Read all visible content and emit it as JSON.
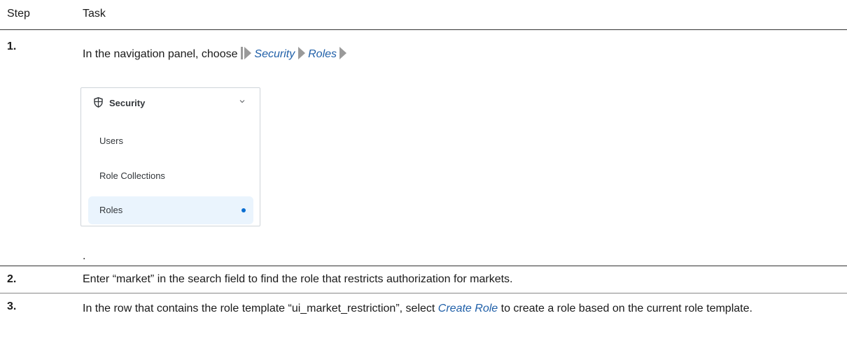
{
  "header": {
    "step": "Step",
    "task": "Task"
  },
  "rows": [
    {
      "step": "1.",
      "text_prefix": "In the navigation panel, choose",
      "menu_path": [
        "Security",
        "Roles"
      ],
      "panel": {
        "title": "Security",
        "items": [
          "Users",
          "Role Collections",
          "Roles"
        ],
        "selected": "Roles"
      },
      "trailing": "."
    },
    {
      "step": "2.",
      "text": "Enter “market” in the search field to find the role that restricts authorization for markets."
    },
    {
      "step": "3.",
      "text_prefix": "In the row that contains the role template “ui_market_restriction”, select",
      "link": "Create Role",
      "text_suffix": "to create a role based on the current role template."
    }
  ],
  "colors": {
    "link": "#1f5fa8",
    "selected_bg": "#eaf4fd",
    "selected_dot": "#0a6ed1"
  }
}
